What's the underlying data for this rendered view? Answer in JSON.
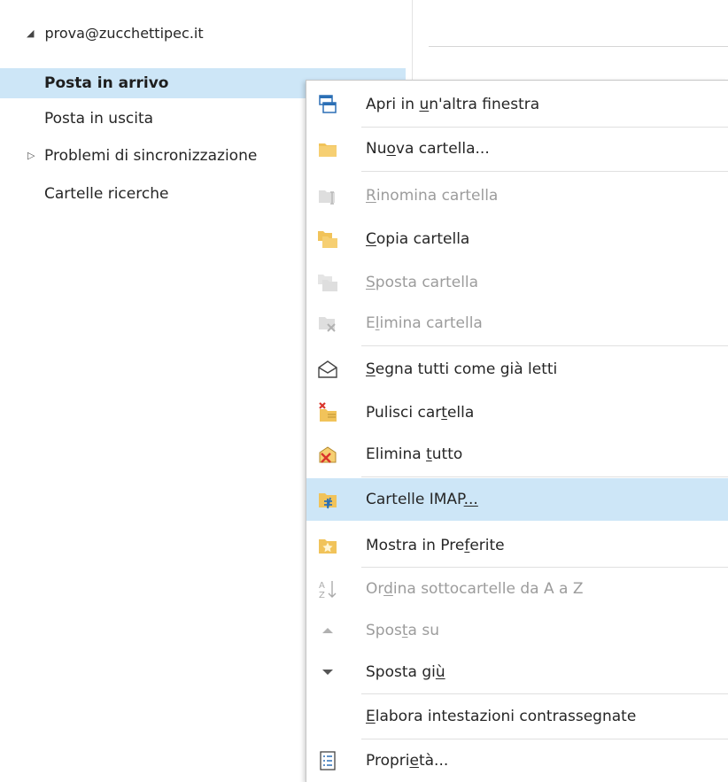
{
  "folder_pane": {
    "account_label": "prova@zucchettipec.it",
    "folders": [
      {
        "label": "Posta in arrivo",
        "selected": true
      },
      {
        "label": "Posta in uscita"
      },
      {
        "label": "Problemi di sincronizzazione",
        "expandable": true
      },
      {
        "label": "Cartelle ricerche"
      }
    ]
  },
  "context_menu": {
    "items": [
      {
        "label": "Apri in un'altra finestra",
        "icon": "open-window-icon"
      },
      {
        "label": "Nuova cartella...",
        "icon": "new-folder-icon"
      },
      {
        "label": "Rinomina cartella",
        "icon": "rename-folder-icon",
        "disabled": true
      },
      {
        "label": "Copia cartella",
        "icon": "copy-folder-icon"
      },
      {
        "label": "Sposta cartella",
        "icon": "move-folder-icon",
        "disabled": true
      },
      {
        "label": "Elimina cartella",
        "icon": "delete-folder-icon",
        "disabled": true
      },
      {
        "label": "Segna tutti come già letti",
        "icon": "mark-read-icon"
      },
      {
        "label": "Pulisci cartella",
        "icon": "clean-folder-icon"
      },
      {
        "label": "Elimina tutto",
        "icon": "delete-all-icon"
      },
      {
        "label": "Cartelle IMAP...",
        "icon": "imap-folders-icon",
        "hover": true
      },
      {
        "label": "Mostra in Preferite",
        "icon": "favorites-icon"
      },
      {
        "label": "Ordina sottocartelle da A a Z",
        "icon": "sort-az-icon",
        "disabled": true
      },
      {
        "label": "Sposta su",
        "icon": "move-up-icon",
        "disabled": true
      },
      {
        "label": "Sposta giù",
        "icon": "move-down-icon"
      },
      {
        "label": "Elabora intestazioni contrassegnate",
        "icon": ""
      },
      {
        "label": "Proprietà...",
        "icon": "properties-icon"
      }
    ]
  },
  "colors": {
    "selection": "#cde6f7",
    "folder_yellow": "#f1c35a",
    "disabled_text": "#9c9c9c",
    "delete_red": "#d9352c",
    "accent_blue": "#2b6fb5"
  }
}
